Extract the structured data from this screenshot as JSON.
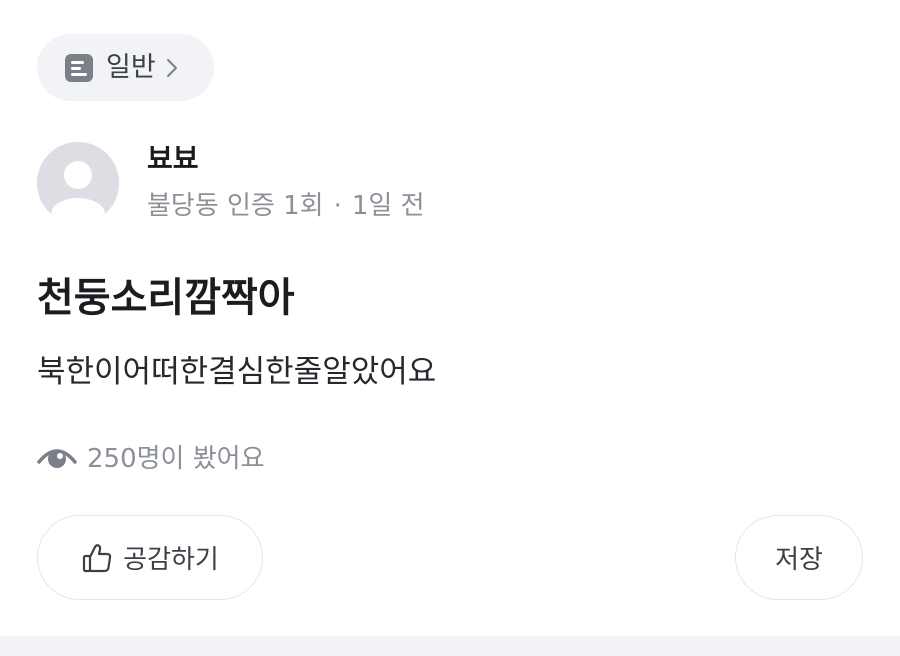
{
  "category": {
    "icon": "document-icon",
    "label": "일반"
  },
  "author": {
    "avatar_icon": "default-avatar-icon",
    "name": "뵤뵤",
    "location": "불당동 인증 1회",
    "separator": "·",
    "time": "1일 전"
  },
  "post": {
    "title": "천둥소리깜짝아",
    "body": "북한이어떠한결심한줄알았어요"
  },
  "views": {
    "icon": "eye-icon",
    "text": "250명이 봤어요"
  },
  "actions": {
    "like_icon": "thumbs-up-icon",
    "like_label": "공감하기",
    "save_label": "저장"
  },
  "colors": {
    "chip_background": "#f2f3f6",
    "muted_text": "#8c9097",
    "border": "#e4e6ea",
    "title_text": "#1b1c1f"
  }
}
